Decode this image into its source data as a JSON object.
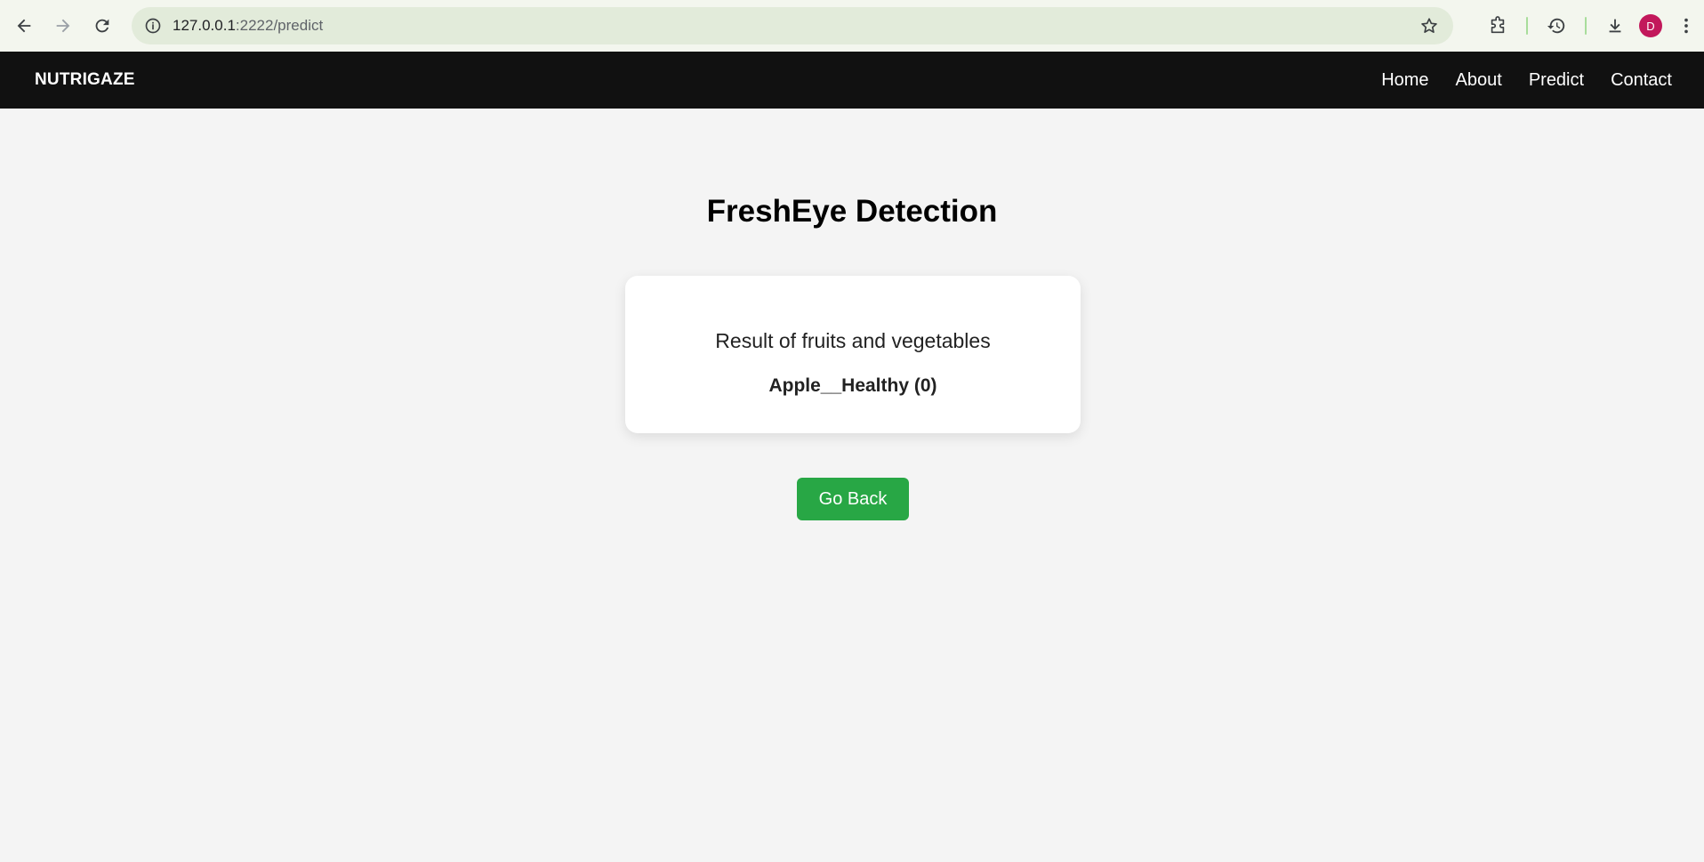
{
  "browser": {
    "url_host": "127.0.0.1",
    "url_path": ":2222/predict",
    "profile_initial": "D",
    "icons": [
      "back-icon",
      "forward-icon",
      "reload-icon",
      "site-info-icon",
      "bookmark-star-icon",
      "extensions-icon",
      "history-icon",
      "download-icon",
      "more-menu-icon"
    ],
    "colors": {
      "chrome_bg": "#f3f6ee",
      "omnibox_bg": "#e2ebda",
      "avatar": "#c2185b"
    }
  },
  "navbar": {
    "brand": "NUTRIGAZE",
    "links": [
      "Home",
      "About",
      "Predict",
      "Contact"
    ],
    "bg_color": "#111111"
  },
  "main": {
    "title": "FreshEye Detection",
    "card": {
      "subtitle": "Result of fruits and vegetables",
      "result": "Apple__Healthy (0)"
    },
    "go_back_label": "Go Back",
    "button_color": "#28a745"
  }
}
